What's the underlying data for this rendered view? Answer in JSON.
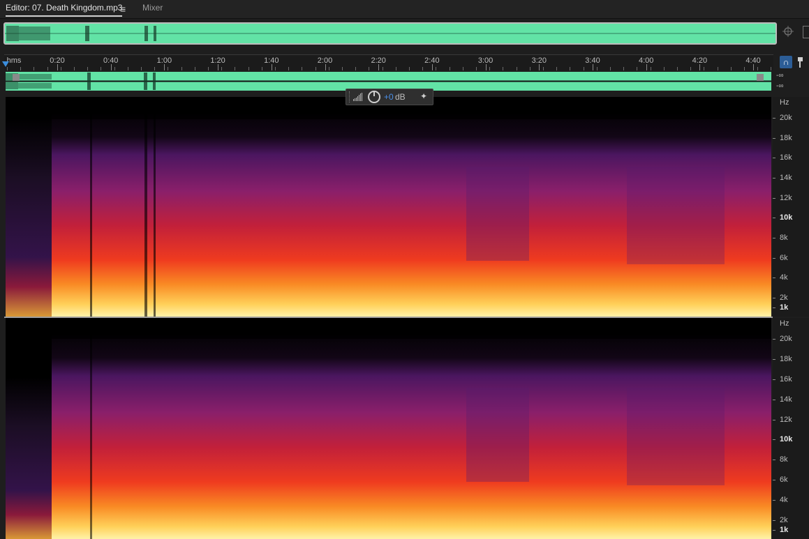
{
  "tabs": {
    "editor_label": "Editor: 07. Death Kingdom.mp3",
    "menu_icon": "≡",
    "mixer_label": "Mixer"
  },
  "timeline": {
    "unit_label": "hms",
    "ticks": [
      "0:20",
      "0:40",
      "1:00",
      "1:20",
      "1:40",
      "2:00",
      "2:20",
      "2:40",
      "3:00",
      "3:20",
      "3:40",
      "4:00",
      "4:20",
      "4:40"
    ]
  },
  "levels": {
    "top": "-∞",
    "bottom": "-∞"
  },
  "hud": {
    "value": "+0",
    "unit": "dB"
  },
  "freq_axis": {
    "unit": "Hz",
    "labels": [
      "20k",
      "18k",
      "16k",
      "14k",
      "12k",
      "10k",
      "8k",
      "6k",
      "4k",
      "2k",
      "1k"
    ]
  },
  "colors": {
    "waveform": "#62e3a6",
    "accent": "#3b8ddb",
    "spectral_low": "#ffe27a",
    "spectral_mid": "#e8261e",
    "spectral_high": "#5a1c6e"
  },
  "icons": [
    "menu-icon",
    "zoom-icon",
    "panel-icon",
    "snap-icon",
    "marker-icon",
    "meter-icon",
    "knob-icon",
    "pin-icon",
    "playhead-icon"
  ]
}
